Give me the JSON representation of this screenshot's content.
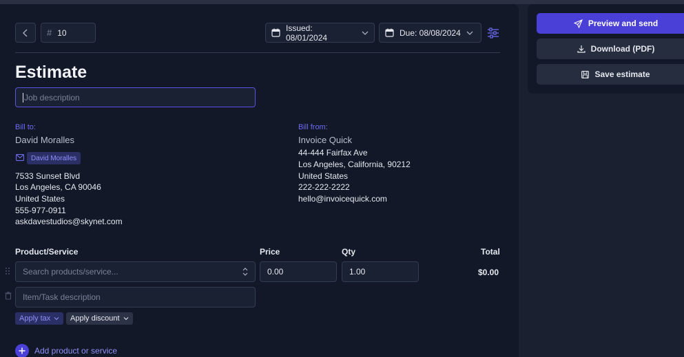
{
  "header": {
    "number_prefix": "#",
    "number_value": "10",
    "issued_label": "Issued: 08/01/2024",
    "due_label": "Due: 08/08/2024"
  },
  "document": {
    "title": "Estimate",
    "job_description_placeholder": "Job description"
  },
  "bill_to": {
    "label": "Bill to:",
    "name": "David Moralles",
    "email_chip": "David Moralles",
    "address1": "7533 Sunset Blvd",
    "address2": "Los Angeles, CA 90046",
    "country": "United States",
    "phone": "555-977-0911",
    "email": "askdavestudios@skynet.com"
  },
  "bill_from": {
    "label": "Bill from:",
    "name": "Invoice Quick",
    "address1": "44-444 Fairfax Ave",
    "address2": "Los Angeles, California, 90212",
    "country": "United States",
    "phone": "222-222-2222",
    "email": "hello@invoicequick.com"
  },
  "items_table": {
    "columns": {
      "product": "Product/Service",
      "price": "Price",
      "qty": "Qty",
      "total": "Total"
    },
    "row": {
      "search_placeholder": "Search products/service...",
      "price": "0.00",
      "qty": "1.00",
      "total": "$0.00",
      "description_placeholder": "Item/Task description"
    },
    "apply_tax": "Apply tax",
    "apply_discount": "Apply discount",
    "add_item": "Add product or service"
  },
  "actions": {
    "preview_send": "Preview and send",
    "download": "Download (PDF)",
    "save": "Save estimate"
  },
  "colors": {
    "background": "#1b2030",
    "panel": "#121828",
    "accent": "#4a3fd6",
    "label_accent": "#6c6cf2"
  }
}
